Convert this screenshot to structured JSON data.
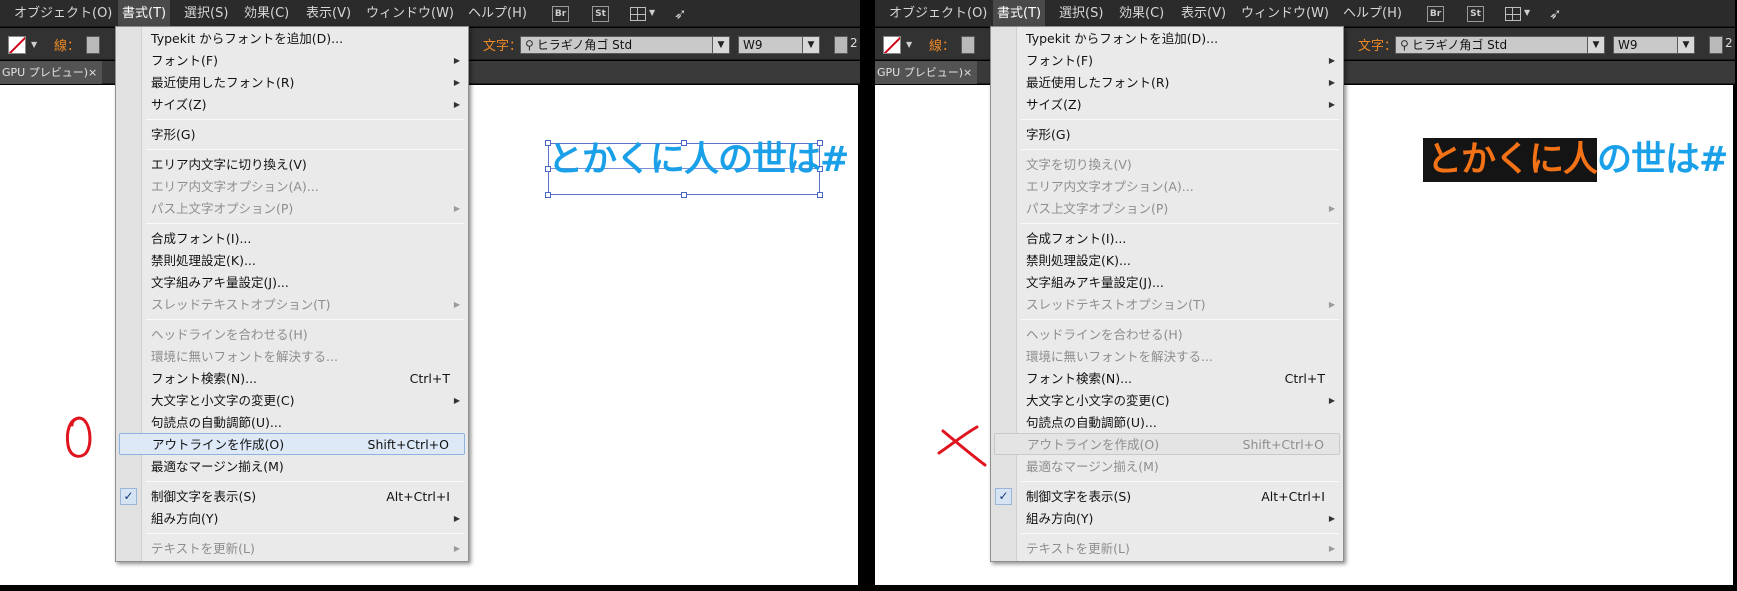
{
  "menubar": {
    "items": [
      "オブジェクト(O)",
      "書式(T)",
      "選択(S)",
      "効果(C)",
      "表示(V)",
      "ウィンドウ(W)",
      "ヘルプ(H)"
    ],
    "icons": {
      "br": "Br",
      "st": "St",
      "workspace": "workspace-switcher-icon",
      "publish": "rocket-icon"
    }
  },
  "controlbar": {
    "stroke_label": "線：",
    "char_label": "文字：",
    "font_value": "ヒラギノ角ゴ Std",
    "weight_value": "W9",
    "size_value": "2"
  },
  "tab": {
    "label": "GPU プレビュー)",
    "close": "×"
  },
  "canvas": {
    "text_left": "とかくに人の世は#",
    "text_right_outlined": "とかくに人",
    "text_right_rest": "の世は#",
    "text_color": "#1aa0e8",
    "outline_fill": "#f47216",
    "outline_bg": "#141414"
  },
  "marks": {
    "left": "○",
    "right": "×",
    "color": "#e0141e"
  },
  "menu": {
    "items_left": [
      {
        "label": "Typekit からフォントを追加(D)..."
      },
      {
        "label": "フォント(F)",
        "sub": true
      },
      {
        "label": "最近使用したフォント(R)",
        "sub": true
      },
      {
        "label": "サイズ(Z)",
        "sub": true
      },
      {
        "label": "字形(G)"
      },
      {
        "label": "エリア内文字に切り換え(V)"
      },
      {
        "label": "エリア内文字オプション(A)...",
        "disabled": true
      },
      {
        "label": "パス上文字オプション(P)",
        "disabled": true,
        "sub": true
      },
      {
        "label": "合成フォント(I)..."
      },
      {
        "label": "禁則処理設定(K)..."
      },
      {
        "label": "文字組みアキ量設定(J)..."
      },
      {
        "label": "スレッドテキストオプション(T)",
        "disabled": true,
        "sub": true
      },
      {
        "label": "ヘッドラインを合わせる(H)",
        "disabled": true
      },
      {
        "label": "環境に無いフォントを解決する...",
        "disabled": true
      },
      {
        "label": "フォント検索(N)...",
        "shortcut": "Ctrl+T"
      },
      {
        "label": "大文字と小文字の変更(C)",
        "sub": true
      },
      {
        "label": "句読点の自動調節(U)..."
      },
      {
        "label": "アウトラインを作成(O)",
        "shortcut": "Shift+Ctrl+O",
        "highlight": true
      },
      {
        "label": "最適なマージン揃え(M)"
      },
      {
        "label": "制御文字を表示(S)",
        "shortcut": "Alt+Ctrl+I",
        "checked": true
      },
      {
        "label": "組み方向(Y)",
        "sub": true
      },
      {
        "label": "テキストを更新(L)",
        "disabled": true,
        "sub": true
      }
    ],
    "items_right": [
      {
        "label": "Typekit からフォントを追加(D)..."
      },
      {
        "label": "フォント(F)",
        "sub": true
      },
      {
        "label": "最近使用したフォント(R)",
        "sub": true
      },
      {
        "label": "サイズ(Z)",
        "sub": true
      },
      {
        "label": "字形(G)"
      },
      {
        "label": "文字を切り換え(V)",
        "disabled": true
      },
      {
        "label": "エリア内文字オプション(A)...",
        "disabled": true
      },
      {
        "label": "パス上文字オプション(P)",
        "disabled": true,
        "sub": true
      },
      {
        "label": "合成フォント(I)..."
      },
      {
        "label": "禁則処理設定(K)..."
      },
      {
        "label": "文字組みアキ量設定(J)..."
      },
      {
        "label": "スレッドテキストオプション(T)",
        "disabled": true,
        "sub": true
      },
      {
        "label": "ヘッドラインを合わせる(H)",
        "disabled": true
      },
      {
        "label": "環境に無いフォントを解決する...",
        "disabled": true
      },
      {
        "label": "フォント検索(N)...",
        "shortcut": "Ctrl+T"
      },
      {
        "label": "大文字と小文字の変更(C)",
        "sub": true
      },
      {
        "label": "句読点の自動調節(U)..."
      },
      {
        "label": "アウトラインを作成(O)",
        "shortcut": "Shift+Ctrl+O",
        "disabled": true,
        "highlight": true
      },
      {
        "label": "最適なマージン揃え(M)",
        "disabled": true
      },
      {
        "label": "制御文字を表示(S)",
        "shortcut": "Alt+Ctrl+I",
        "checked": true
      },
      {
        "label": "組み方向(Y)",
        "sub": true
      },
      {
        "label": "テキストを更新(L)",
        "disabled": true,
        "sub": true
      }
    ]
  }
}
